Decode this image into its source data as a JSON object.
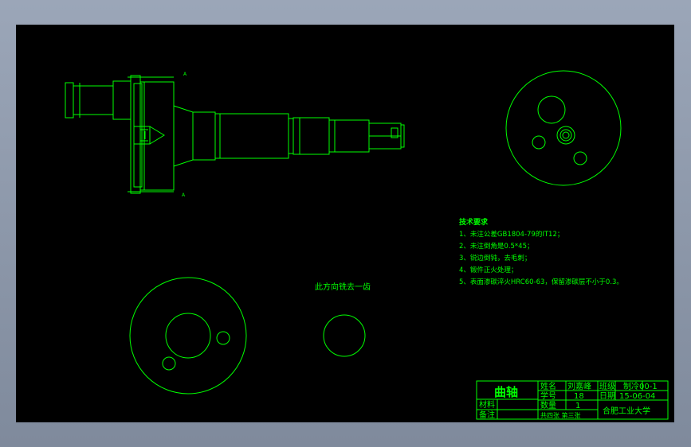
{
  "drawing": {
    "section_mark_top": "A",
    "section_mark_bottom": "A",
    "note_mill_tooth": "此方向铣去一齿"
  },
  "tech_requirements": {
    "title": "技术要求",
    "items": [
      "1、未注公差GB1804-79的IT12；",
      "2、未注倒角是0.5*45；",
      "3、锐边倒钝，去毛刺；",
      "4、锻件正火处理；",
      "5、表面渗碳淬火HRC60-63，保留渗碳层不小于0.3。"
    ]
  },
  "title_block": {
    "part_name": "曲轴",
    "name_label": "姓名",
    "name_value": "刘嘉峰",
    "class_label": "班级",
    "class_value": "制冷00-1",
    "id_label": "学号",
    "id_value": "18",
    "date_label": "日期",
    "date_value": "15-06-04",
    "material_label": "材料",
    "qty_label": "数量",
    "qty_value": "1",
    "remark_label": "备注",
    "sheet_info": "共四张  第三张",
    "school": "合肥工业大学"
  },
  "colors": {
    "line": "#00ff00",
    "background": "#000000"
  }
}
